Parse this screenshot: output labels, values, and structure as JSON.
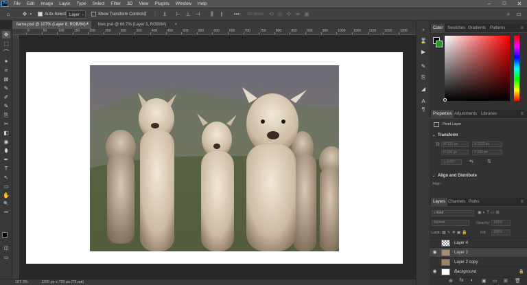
{
  "app": {
    "logo": "Ps",
    "window_controls": [
      "–",
      "▢",
      "✕"
    ]
  },
  "menu": [
    "File",
    "Edit",
    "Image",
    "Layer",
    "Type",
    "Select",
    "Filter",
    "3D",
    "View",
    "Plugins",
    "Window",
    "Help"
  ],
  "options": {
    "auto_select_label": "Auto-Select:",
    "auto_select_value": "Layer",
    "transform_controls_label": "Show Transform Controls",
    "mode_label": "3D Mode:",
    "more": "•••"
  },
  "tabs": [
    {
      "label": "llama.psd @ 107% (Layer 8, RGB/8#) *",
      "close": "×"
    },
    {
      "label": "hive.psd @ 66.7% (Layer 3, RGB/8#)",
      "close": "×"
    }
  ],
  "ruler": [
    "0",
    "50",
    "100",
    "150",
    "200",
    "250",
    "300",
    "350",
    "400",
    "450",
    "500",
    "550",
    "600",
    "650",
    "700",
    "750",
    "800",
    "850",
    "900",
    "950",
    "1000",
    "1050",
    "1100",
    "1150",
    "1200",
    "1250"
  ],
  "status": {
    "zoom": "107.3%",
    "doc_info": "1200 px x 720 px (72 ppi)"
  },
  "color_panel": {
    "tabs": [
      "Color",
      "Swatches",
      "Gradients",
      "Patterns"
    ],
    "hue": "#ff0000",
    "fg": "#000000",
    "bg": "#1ea01e"
  },
  "properties_panel": {
    "tabs": [
      "Properties",
      "Adjustments",
      "Libraries"
    ],
    "kind": "Pixel Layer",
    "transform_heading": "Transform",
    "w": "W  131 px",
    "x": "X  1123 px",
    "h": "H  100 px",
    "y": "Y  590 px",
    "angle": "△ 0.00°",
    "align_heading": "Align and Distribute",
    "align_label": "Align:"
  },
  "layers_panel": {
    "tabs": [
      "Layers",
      "Channels",
      "Paths"
    ],
    "kind_label": "Kind",
    "blend": "Normal",
    "opacity_label": "Opacity:",
    "opacity_value": "100%",
    "lock_label": "Lock:",
    "fill_label": "Fill:",
    "fill_value": "100%",
    "layers": [
      {
        "name": "Layer 4"
      },
      {
        "name": "Layer 2"
      },
      {
        "name": "Layer 2 copy"
      },
      {
        "name": "Background"
      }
    ],
    "footer_icons": [
      "⊕",
      "fx",
      "◐",
      "▣",
      "▭",
      "⊞",
      "🗑"
    ]
  },
  "tools": [
    "✥",
    "⬚",
    "⌒",
    "✦",
    "⌗",
    "⊠",
    "✎",
    "✐",
    "✎",
    "⎘",
    "✂",
    "◧",
    "◉",
    "⬮",
    "✒",
    "T",
    "↖",
    "▭",
    "✋",
    "🔍",
    "•••"
  ]
}
